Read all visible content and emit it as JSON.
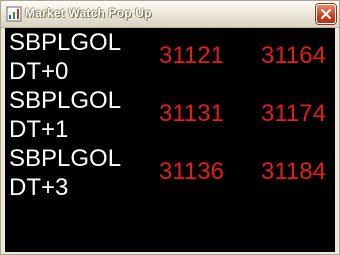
{
  "window": {
    "title": "Market Watch Pop Up",
    "icons": {
      "app": "chart-app-icon",
      "close": "close-icon"
    },
    "colors": {
      "content_bg": "#000000",
      "symbol_text": "#ffffff",
      "price_text": "#e41c1c",
      "close_button": "#c8421f"
    }
  },
  "quotes": [
    {
      "symbol_line1": "SBPLGOL",
      "symbol_line2": "DT+0",
      "bid": "31121",
      "ask": "31164"
    },
    {
      "symbol_line1": "SBPLGOL",
      "symbol_line2": "DT+1",
      "bid": "31131",
      "ask": "31174"
    },
    {
      "symbol_line1": "SBPLGOL",
      "symbol_line2": "DT+3",
      "bid": "31136",
      "ask": "31184"
    }
  ]
}
